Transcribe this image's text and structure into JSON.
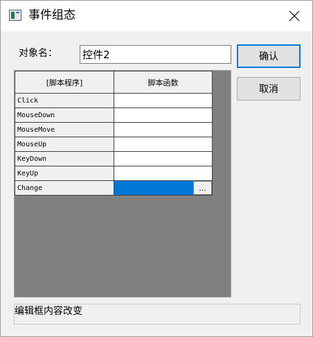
{
  "window": {
    "title": "事件组态"
  },
  "object_name": {
    "label": "对象名：",
    "value": "控件2"
  },
  "buttons": {
    "ok_label": "确认",
    "cancel_label": "取消"
  },
  "grid": {
    "headers": [
      "[脚本程序]",
      "脚本函数"
    ],
    "rows": [
      {
        "event": "Click",
        "function": ""
      },
      {
        "event": "MouseDown",
        "function": ""
      },
      {
        "event": "MouseMove",
        "function": ""
      },
      {
        "event": "MouseUp",
        "function": ""
      },
      {
        "event": "KeyDown",
        "function": ""
      },
      {
        "event": "KeyUp",
        "function": ""
      },
      {
        "event": "Change",
        "function": ""
      }
    ],
    "selected_row": "Change",
    "browse_button": "..."
  },
  "description": "编辑框内容改变",
  "icons": {
    "app": "app-window-icon",
    "close": "close-icon"
  },
  "colors": {
    "selection": "#0078d7",
    "grid_background": "#808080"
  }
}
